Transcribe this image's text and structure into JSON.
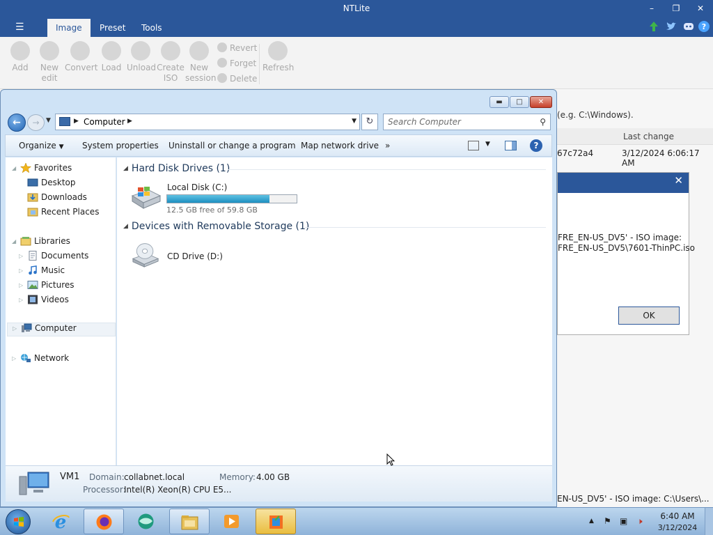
{
  "ntlite": {
    "title": "NTLite",
    "tabs": [
      {
        "label": "Image",
        "active": true
      },
      {
        "label": "Preset",
        "active": false
      },
      {
        "label": "Tools",
        "active": false
      }
    ],
    "ribbon": {
      "add": "Add",
      "new_edit_1": "New",
      "new_edit_2": "edit",
      "convert": "Convert",
      "load": "Load",
      "unload": "Unload",
      "create_iso_1": "Create",
      "create_iso_2": "ISO",
      "new_session_1": "New",
      "new_session_2": "session",
      "revert": "Revert",
      "forget": "Forget",
      "delete": "Delete",
      "refresh": "Refresh"
    },
    "path_hint": "(e.g. C:\\Windows).",
    "column_last_change": "Last change",
    "row_hash": "67c72a4",
    "row_date": "3/12/2024 6:06:17 AM",
    "dialog": {
      "line1": "FRE_EN-US_DV5' - ISO image:",
      "line2": "FRE_EN-US_DV5\\7601-ThinPC.iso",
      "ok_label": "OK"
    },
    "status_text": "EN-US_DV5' - ISO image: C:\\Users\\..."
  },
  "explorer": {
    "address": "Computer",
    "search_placeholder": "Search Computer",
    "toolbar": {
      "organize": "Organize",
      "system_properties": "System properties",
      "uninstall": "Uninstall or change a program",
      "map_network_drive": "Map network drive",
      "more": "»"
    },
    "nav": {
      "favorites": "Favorites",
      "desktop": "Desktop",
      "downloads": "Downloads",
      "recent_places": "Recent Places",
      "libraries": "Libraries",
      "documents": "Documents",
      "music": "Music",
      "pictures": "Pictures",
      "videos": "Videos",
      "computer": "Computer",
      "network": "Network"
    },
    "groups": {
      "hdd": "Hard Disk Drives (1)",
      "removable": "Devices with Removable Storage (1)"
    },
    "drive_c": {
      "name": "Local Disk (C:)",
      "free_text": "12.5 GB free of 59.8 GB",
      "used_fraction": 0.79
    },
    "drive_d": {
      "name": "CD Drive (D:)"
    },
    "details": {
      "computer_name": "VM1",
      "domain_label": "Domain:",
      "domain_value": "collabnet.local",
      "memory_label": "Memory:",
      "memory_value": "4.00 GB",
      "processor_label": "Processor:",
      "processor_value": "Intel(R) Xeon(R) CPU E5..."
    }
  },
  "taskbar": {
    "time": "6:40 AM",
    "date": "3/12/2024"
  },
  "colors": {
    "ntlite_blue": "#2b579a",
    "explorer_frame": "#cfe3f6",
    "disk_fill": "#1d8fc0",
    "taskbar": "#a9c5e3"
  }
}
